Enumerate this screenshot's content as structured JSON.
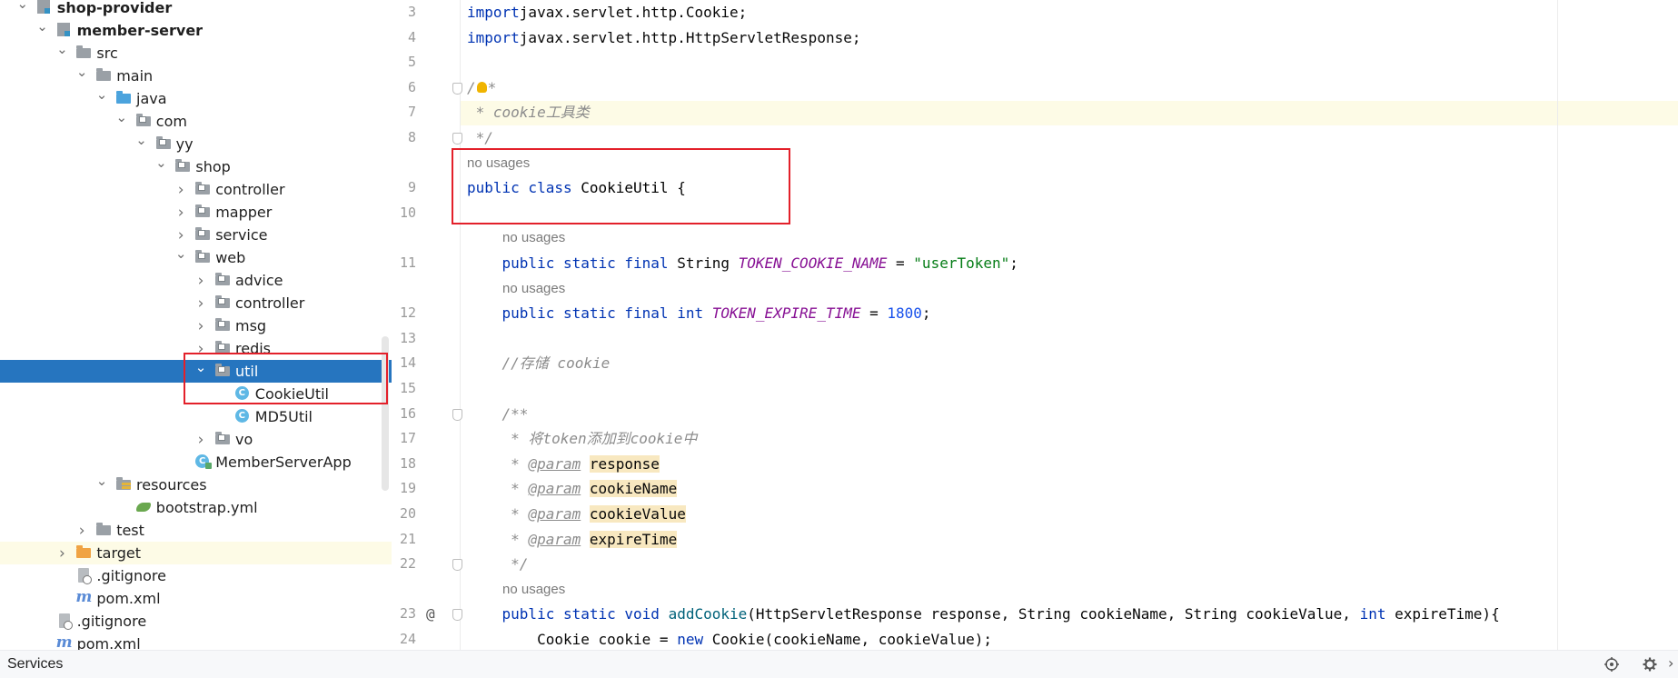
{
  "tree": {
    "items": [
      {
        "label": "shop-provider",
        "depth": 1,
        "chevron": "down",
        "icon": "module-icon",
        "bold": true
      },
      {
        "label": "member-server",
        "depth": 2,
        "chevron": "down",
        "icon": "module-icon",
        "bold": true
      },
      {
        "label": "src",
        "depth": 3,
        "chevron": "down",
        "icon": "folder-icon"
      },
      {
        "label": "main",
        "depth": 4,
        "chevron": "down",
        "icon": "folder-icon"
      },
      {
        "label": "java",
        "depth": 5,
        "chevron": "down",
        "icon": "source-folder-icon"
      },
      {
        "label": "com",
        "depth": 6,
        "chevron": "down",
        "icon": "package-icon"
      },
      {
        "label": "yy",
        "depth": 7,
        "chevron": "down",
        "icon": "package-icon"
      },
      {
        "label": "shop",
        "depth": 8,
        "chevron": "down",
        "icon": "package-icon"
      },
      {
        "label": "controller",
        "depth": 9,
        "chevron": "right",
        "icon": "package-icon"
      },
      {
        "label": "mapper",
        "depth": 9,
        "chevron": "right",
        "icon": "package-icon"
      },
      {
        "label": "service",
        "depth": 9,
        "chevron": "right",
        "icon": "package-icon"
      },
      {
        "label": "web",
        "depth": 9,
        "chevron": "down",
        "icon": "package-icon"
      },
      {
        "label": "advice",
        "depth": 10,
        "chevron": "right",
        "icon": "package-icon"
      },
      {
        "label": "controller",
        "depth": 10,
        "chevron": "right",
        "icon": "package-icon"
      },
      {
        "label": "msg",
        "depth": 10,
        "chevron": "right",
        "icon": "package-icon"
      },
      {
        "label": "redis",
        "depth": 10,
        "chevron": "right",
        "icon": "package-icon"
      },
      {
        "label": "util",
        "depth": 10,
        "chevron": "down",
        "icon": "package-icon",
        "selected": true
      },
      {
        "label": "CookieUtil",
        "depth": 11,
        "chevron": "",
        "icon": "java-class-icon"
      },
      {
        "label": "MD5Util",
        "depth": 11,
        "chevron": "",
        "icon": "java-class-icon"
      },
      {
        "label": "vo",
        "depth": 10,
        "chevron": "right",
        "icon": "package-icon"
      },
      {
        "label": "MemberServerApp",
        "depth": 9,
        "chevron": "",
        "icon": "spring-boot-class-icon"
      },
      {
        "label": "resources",
        "depth": 5,
        "chevron": "down",
        "icon": "resources-folder-icon"
      },
      {
        "label": "bootstrap.yml",
        "depth": 6,
        "chevron": "",
        "icon": "yaml-file-icon"
      },
      {
        "label": "test",
        "depth": 4,
        "chevron": "right",
        "icon": "folder-icon"
      },
      {
        "label": "target",
        "depth": 3,
        "chevron": "right",
        "icon": "excluded-folder-icon",
        "highlight": true
      },
      {
        "label": ".gitignore",
        "depth": 3,
        "chevron": "",
        "icon": "gitignore-icon"
      },
      {
        "label": "pom.xml",
        "depth": 3,
        "chevron": "",
        "icon": "maven-icon"
      },
      {
        "label": ".gitignore",
        "depth": 2,
        "chevron": "",
        "icon": "gitignore-icon"
      },
      {
        "label": "pom.xml",
        "depth": 2,
        "chevron": "",
        "icon": "maven-icon"
      }
    ]
  },
  "editor": {
    "lines": [
      {
        "n": "3",
        "tokens": [
          [
            "kw",
            "import"
          ],
          [
            "",
            "javax.servlet.http.Cookie;"
          ]
        ]
      },
      {
        "n": "4",
        "tokens": [
          [
            "kw",
            "import"
          ],
          [
            "",
            "javax.servlet.http.HttpServletResponse;"
          ]
        ]
      },
      {
        "n": "5",
        "tokens": []
      },
      {
        "n": "6",
        "tokens": [
          [
            "cm",
            "/"
          ],
          [
            "bulb",
            ""
          ],
          [
            "cm",
            "*"
          ]
        ],
        "fold": true
      },
      {
        "n": "7",
        "tokens": [
          [
            "cm",
            " * cookie工具类"
          ]
        ]
      },
      {
        "n": "8",
        "tokens": [
          [
            "cm",
            " */"
          ]
        ],
        "fold": true
      },
      {
        "hint": "no usages",
        "indent": 0
      },
      {
        "n": "9",
        "tokens": [
          [
            "kw",
            "public class "
          ],
          [
            "cl",
            "CookieUtil"
          ],
          [
            "",
            " {"
          ]
        ]
      },
      {
        "n": "10",
        "tokens": []
      },
      {
        "hint": "no usages",
        "indent": 1
      },
      {
        "n": "11",
        "tokens": [
          [
            "",
            "    "
          ],
          [
            "kw",
            "public static final "
          ],
          [
            "",
            "String "
          ],
          [
            "cn",
            "TOKEN_COOKIE_NAME"
          ],
          [
            "",
            " = "
          ],
          [
            "st",
            "\"userToken\""
          ],
          [
            "",
            ";"
          ]
        ]
      },
      {
        "hint": "no usages",
        "indent": 1
      },
      {
        "n": "12",
        "tokens": [
          [
            "",
            "    "
          ],
          [
            "kw",
            "public static final int "
          ],
          [
            "cn",
            "TOKEN_EXPIRE_TIME"
          ],
          [
            "",
            " = "
          ],
          [
            "nm",
            "1800"
          ],
          [
            "",
            ";"
          ]
        ]
      },
      {
        "n": "13",
        "tokens": []
      },
      {
        "n": "14",
        "tokens": [
          [
            "",
            "    "
          ],
          [
            "cm",
            "//存储 cookie"
          ]
        ]
      },
      {
        "n": "15",
        "tokens": []
      },
      {
        "n": "16",
        "tokens": [
          [
            "",
            "    "
          ],
          [
            "cm",
            "/**"
          ]
        ],
        "fold": true
      },
      {
        "n": "17",
        "tokens": [
          [
            "",
            "    "
          ],
          [
            "cm",
            " * 将token添加到cookie中"
          ]
        ]
      },
      {
        "n": "18",
        "tokens": [
          [
            "",
            "    "
          ],
          [
            "cm",
            " * "
          ],
          [
            "tg",
            "@param"
          ],
          [
            "cm",
            " "
          ],
          [
            "pv",
            "response"
          ]
        ]
      },
      {
        "n": "19",
        "tokens": [
          [
            "",
            "    "
          ],
          [
            "cm",
            " * "
          ],
          [
            "tg",
            "@param"
          ],
          [
            "cm",
            " "
          ],
          [
            "pv",
            "cookieName"
          ]
        ]
      },
      {
        "n": "20",
        "tokens": [
          [
            "",
            "    "
          ],
          [
            "cm",
            " * "
          ],
          [
            "tg",
            "@param"
          ],
          [
            "cm",
            " "
          ],
          [
            "pv",
            "cookieValue"
          ]
        ]
      },
      {
        "n": "21",
        "tokens": [
          [
            "",
            "    "
          ],
          [
            "cm",
            " * "
          ],
          [
            "tg",
            "@param"
          ],
          [
            "cm",
            " "
          ],
          [
            "pv",
            "expireTime"
          ]
        ]
      },
      {
        "n": "22",
        "tokens": [
          [
            "",
            "    "
          ],
          [
            "cm",
            " */"
          ]
        ],
        "fold": true
      },
      {
        "hint": "no usages",
        "indent": 1
      },
      {
        "n": "23",
        "tokens": [
          [
            "",
            "    "
          ],
          [
            "kw",
            "public static void "
          ],
          [
            "mt",
            "addCookie"
          ],
          [
            "",
            "(HttpServletResponse response, String cookieName, String cookieValue, "
          ],
          [
            "kw",
            "int"
          ],
          [
            "",
            " expireTime){"
          ]
        ],
        "fold": true,
        "at": "@"
      },
      {
        "n": "24",
        "tokens": [
          [
            "",
            "        Cookie cookie = "
          ],
          [
            "kw",
            "new "
          ],
          [
            "",
            "Cookie(cookieName, cookieValue);"
          ]
        ]
      }
    ]
  },
  "statusbar": {
    "services_label": "Services"
  },
  "colors": {
    "selection": "#2675bf",
    "annotation_box": "#e3202a",
    "keyword": "#0033b3",
    "string": "#067d17",
    "number": "#1750eb",
    "comment": "#8c8c8c"
  }
}
